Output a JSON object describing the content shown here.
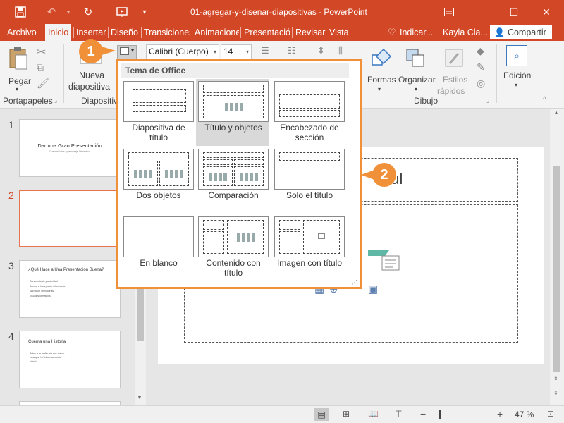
{
  "window": {
    "title": "01-agregar-y-disenar-diapositivas - PowerPoint",
    "user": "Kayla Cla...",
    "share": "Compartir",
    "tell_me": "Indicar..."
  },
  "tabs": [
    "Archivo",
    "Inicio",
    "Insertar",
    "Diseño",
    "Transiciones",
    "Animaciones",
    "Presentació",
    "Revisar",
    "Vista"
  ],
  "ribbon": {
    "paste": "Pegar",
    "clipboard_group": "Portapapeles",
    "new_slide_line1": "Nueva",
    "new_slide_line2": "diapositiva",
    "slides_group": "Diapositiva",
    "font_name": "Calibri (Cuerpo)",
    "font_size": "14",
    "shapes": "Formas",
    "arrange": "Organizar",
    "styles_line1": "Estilos",
    "styles_line2": "rápidos",
    "drawing_group": "Dibujo",
    "edit": "Edición"
  },
  "layout_gallery": {
    "header": "Tema de Office",
    "items": [
      {
        "line1": "Diapositiva de",
        "line2": "título"
      },
      {
        "line1": "Título y objetos",
        "line2": ""
      },
      {
        "line1": "Encabezado de",
        "line2": "sección"
      },
      {
        "line1": "Dos objetos",
        "line2": ""
      },
      {
        "line1": "Comparación",
        "line2": ""
      },
      {
        "line1": "Solo el título",
        "line2": ""
      },
      {
        "line1": "En blanco",
        "line2": ""
      },
      {
        "line1": "Contenido con",
        "line2": "título"
      },
      {
        "line1": "Imagen con título",
        "line2": ""
      }
    ]
  },
  "slides": [
    {
      "num": "1",
      "title": "Dar una Gran Presentación",
      "subtitle": "CustomGuide Aprendizaje Interactivo"
    },
    {
      "num": "2",
      "title": "",
      "subtitle": ""
    },
    {
      "num": "3",
      "title": "¿Qué Hace a Una Presentación Buena?",
      "bullets": [
        "Conocimiento y autoridad",
        "Acerca e Incorporate información",
        "Narración de historias",
        "Visuales llamativos"
      ]
    },
    {
      "num": "4",
      "title": "Cuenta una Historia",
      "bullets": [
        "Sobre a la audiencia que quiere",
        "para que 'ok' interesar con tu",
        "historia"
      ]
    }
  ],
  "canvas": {
    "partial_title": "ítul"
  },
  "status": {
    "zoom": "47 %"
  },
  "callouts": [
    "1",
    "2"
  ],
  "colors": {
    "accent": "#d24726",
    "callout": "#f0913a",
    "selected_slide": "#e8734f"
  }
}
